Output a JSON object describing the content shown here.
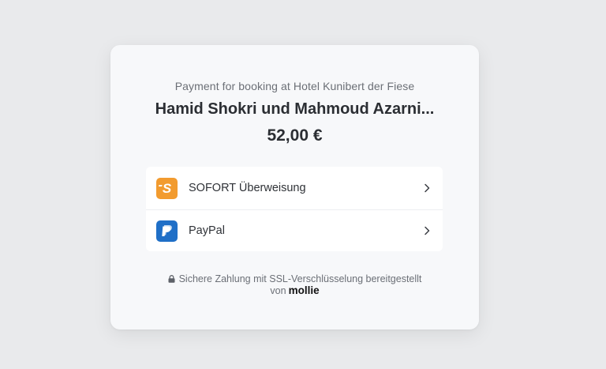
{
  "header": {
    "subtitle": "Payment for booking at Hotel Kunibert der Fiese",
    "merchant": "Hamid Shokri und Mahmoud Azarni...",
    "amount": "52,00 €"
  },
  "methods": [
    {
      "label": "SOFORT Überweisung",
      "icon": "sofort-icon",
      "color": "#f29b2f"
    },
    {
      "label": "PayPal",
      "icon": "paypal-icon",
      "color": "#1f6fc7"
    }
  ],
  "footer": {
    "security_text": "Sichere Zahlung mit SSL-Verschlüsselung bereitgestellt",
    "by_text": "von",
    "brand": "mollie"
  },
  "colors": {
    "background": "#e9eaec",
    "card": "#f7f8fa"
  }
}
